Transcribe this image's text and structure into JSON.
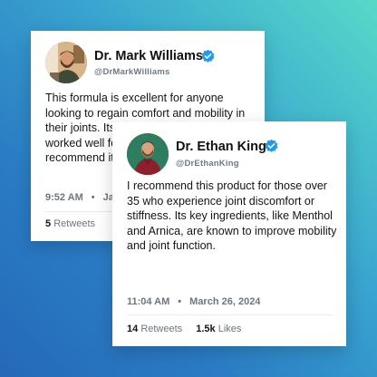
{
  "colors": {
    "verified": "#1d9bf0",
    "background_top": "#57d9c8",
    "background_bottom": "#2569b8"
  },
  "tweets": [
    {
      "name": "Dr. Mark Williams",
      "handle": "@DrMarkWilliams",
      "avatar_icon": "profile-photo-bearded-man",
      "verified_icon": "verified-badge-icon",
      "text": "This formula is excellent for anyone looking to regain comfort and mobility in their joints. Its natural ingredients have worked well for my patients, and I recommend it.",
      "time": "9:52 AM",
      "date": "Ja",
      "retweets_count": "5",
      "retweets_label": "Retweets",
      "likes_count": "",
      "likes_label": ""
    },
    {
      "name": "Dr. Ethan King",
      "handle": "@DrEthanKing",
      "avatar_icon": "profile-photo-man-red-shirt",
      "verified_icon": "verified-badge-icon",
      "text": "I recommend this product for those over 35 who experience joint discomfort or stiffness. Its key ingredients, like Menthol and Arnica, are known to improve mobility and joint function.",
      "time": "11:04 AM",
      "separator": "•",
      "date": "March 26, 2024",
      "retweets_count": "14",
      "retweets_label": "Retweets",
      "likes_count": "1.5k",
      "likes_label": "Likes"
    }
  ]
}
